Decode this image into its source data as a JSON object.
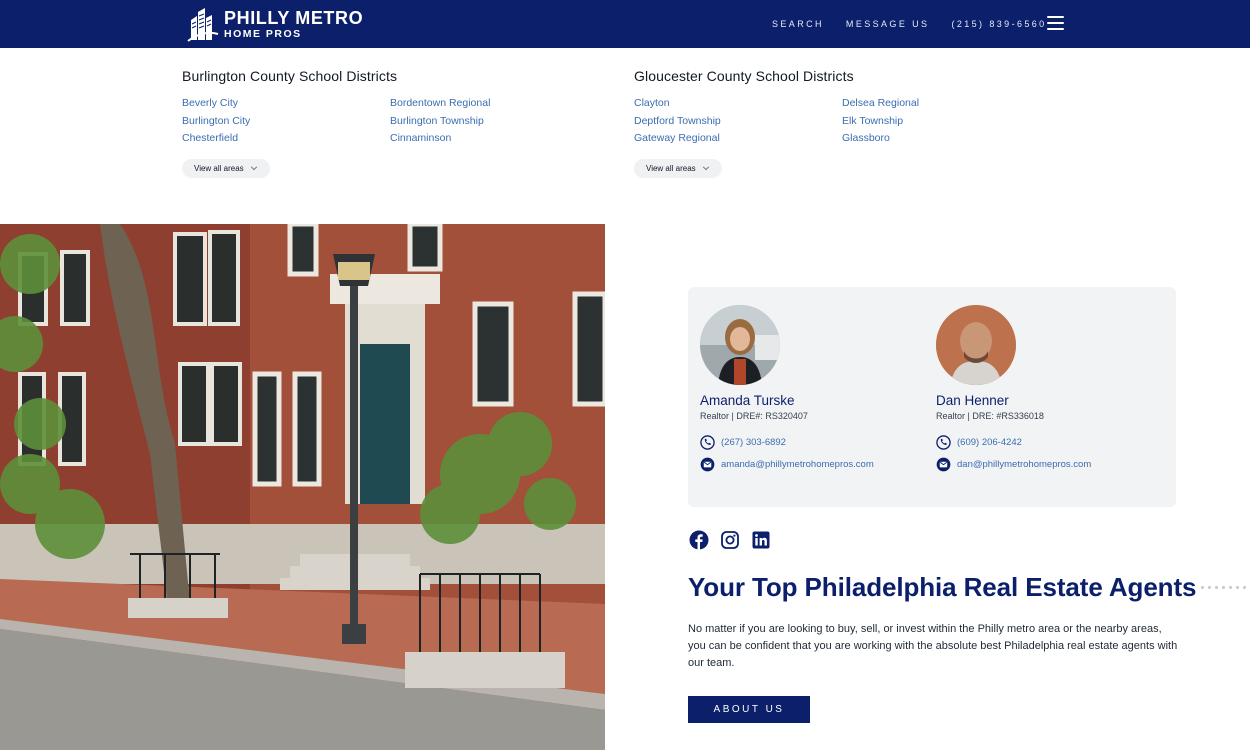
{
  "header": {
    "logo": {
      "line1": "PHILLY METRO",
      "line2": "HOME PROS"
    },
    "nav": [
      {
        "label": "SEARCH"
      },
      {
        "label": "MESSAGE US"
      },
      {
        "label": "(215) 839-6560"
      }
    ]
  },
  "districts": [
    {
      "title": "Burlington County School Districts",
      "items": [
        "Beverly City",
        "Bordentown Regional",
        "Burlington City",
        "Burlington Township",
        "Chesterfield",
        "Cinnaminson"
      ],
      "view_all": "View all areas"
    },
    {
      "title": "Gloucester County School Districts",
      "items": [
        "Clayton",
        "Delsea Regional",
        "Deptford Township",
        "Elk Township",
        "Gateway Regional",
        "Glassboro"
      ],
      "view_all": "View all areas"
    }
  ],
  "agents": [
    {
      "name": "Amanda Turske",
      "role": "Realtor | DRE#: RS320407",
      "phone": "(267) 303-6892",
      "email": "amanda@phillymetrohomepros.com"
    },
    {
      "name": "Dan Henner",
      "role": "Realtor | DRE: #RS336018",
      "phone": "(609) 206-4242",
      "email": "dan@phillymetrohomepros.com"
    }
  ],
  "social": [
    "facebook-icon",
    "instagram-icon",
    "linkedin-icon"
  ],
  "intro": {
    "headline": "Your Top Philadelphia Real Estate Agents",
    "body": "No matter if you are looking to buy, sell, or invest within the Philly metro area or the nearby areas, you can be confident that you are working with the absolute best Philadelphia real estate agents with our team.",
    "button": "ABOUT US"
  },
  "colors": {
    "brand_navy": "#0b1f6b",
    "link_blue": "#3b6db0",
    "card_bg": "#f2f3f5"
  }
}
